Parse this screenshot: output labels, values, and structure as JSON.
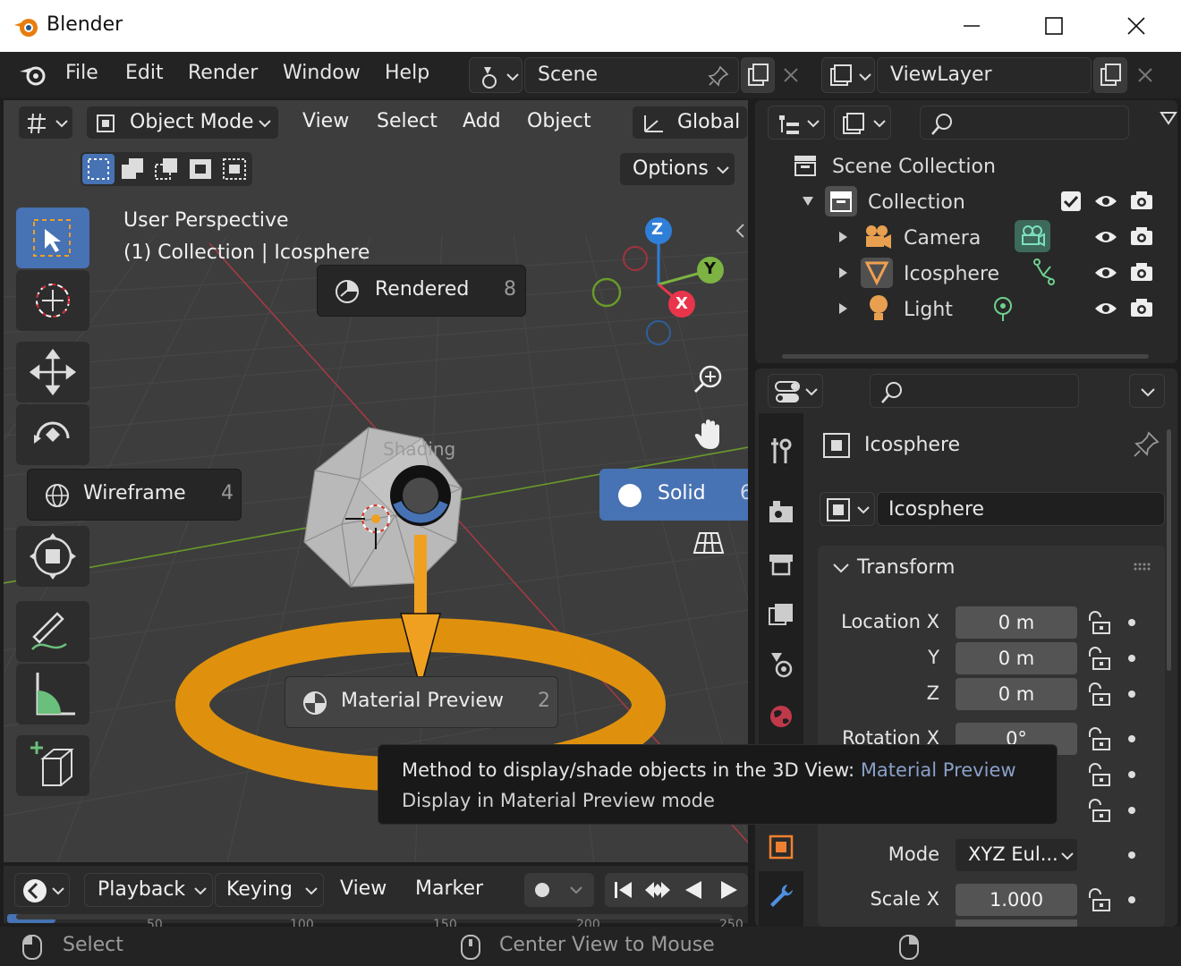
{
  "window": {
    "title": "Blender"
  },
  "topbar": {
    "menus": [
      "File",
      "Edit",
      "Render",
      "Window",
      "Help"
    ],
    "scene": "Scene",
    "view_layer": "ViewLayer"
  },
  "viewport_header": {
    "mode": "Object Mode",
    "menus": [
      "View",
      "Select",
      "Add",
      "Object"
    ],
    "transform": "Global",
    "options": "Options"
  },
  "viewport": {
    "perspective": "User Perspective",
    "context": "(1) Collection | Icosphere",
    "pie_title": "Shading",
    "pie": {
      "rendered": {
        "label": "Rendered",
        "key": "8"
      },
      "wireframe": {
        "label": "Wireframe",
        "key": "4"
      },
      "solid": {
        "label": "Solid",
        "key": "6"
      },
      "material": {
        "label": "Material Preview",
        "key": "2"
      }
    },
    "gizmo": {
      "x": "X",
      "y": "Y",
      "z": "Z"
    }
  },
  "tooltip": {
    "line1_prefix": "Method to display/shade objects in the 3D View: ",
    "line1_value": "Material Preview",
    "line2": "Display in Material Preview mode"
  },
  "outliner": {
    "scene_collection": "Scene Collection",
    "collection": "Collection",
    "items": [
      {
        "label": "Camera"
      },
      {
        "label": "Icosphere"
      },
      {
        "label": "Light"
      }
    ]
  },
  "properties": {
    "object_name": "Icosphere",
    "data_name": "Icosphere",
    "panel": "Transform",
    "location": {
      "label_x": "Location X",
      "label_y": "Y",
      "label_z": "Z",
      "x": "0 m",
      "y": "0 m",
      "z": "0 m"
    },
    "rotation": {
      "label_x": "Rotation X",
      "x": "0°"
    },
    "mode": {
      "label": "Mode",
      "value": "XYZ Eul..."
    },
    "scale": {
      "label_x": "Scale X",
      "x": "1.000"
    }
  },
  "timeline": {
    "menus": [
      "Playback",
      "Keying",
      "View",
      "Marker"
    ],
    "ticks": [
      "50",
      "100",
      "150",
      "200",
      "250"
    ]
  },
  "status": {
    "left": "Select",
    "middle": "Center View to Mouse"
  },
  "colors": {
    "accent_blue": "#4772b3",
    "orange": "#e8960c",
    "axis_x": "#e8354b",
    "axis_y": "#7cb342",
    "axis_z": "#2f7fd8"
  }
}
